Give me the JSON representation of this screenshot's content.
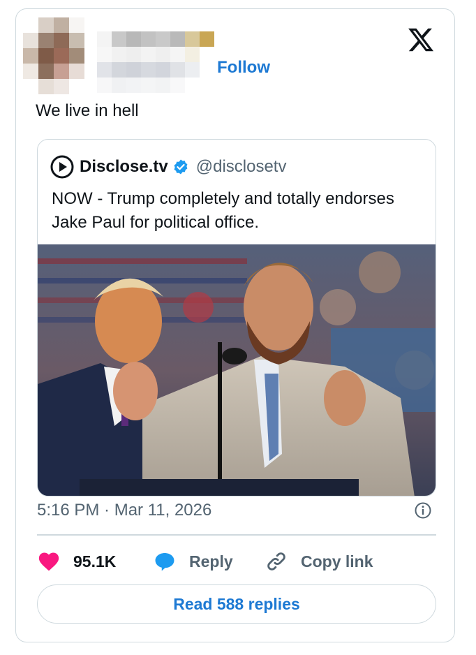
{
  "author": {
    "name_obscured": true
  },
  "follow_label": "Follow",
  "tweet_text": "We live in hell",
  "quoted": {
    "name": "Disclose.tv",
    "handle": "@disclosetv",
    "verified": true,
    "text": "NOW - Trump completely and totally endorses Jake Paul for political office."
  },
  "timestamp": "5:16 PM · Mar 11, 2026",
  "actions": {
    "likes": "95.1K",
    "reply_label": "Reply",
    "copy_link_label": "Copy link"
  },
  "read_replies_label": "Read 588 replies",
  "icons": {
    "brand": "x-logo-icon",
    "like": "heart-icon",
    "reply": "speech-bubble-icon",
    "copy": "link-icon",
    "info": "info-icon",
    "verified": "verified-badge-icon",
    "source_logo": "play-circle-icon"
  },
  "colors": {
    "accent": "#1d79d3",
    "like": "#f91880",
    "reply": "#1d9bf0",
    "muted": "#536471",
    "border": "#cfd9de"
  }
}
